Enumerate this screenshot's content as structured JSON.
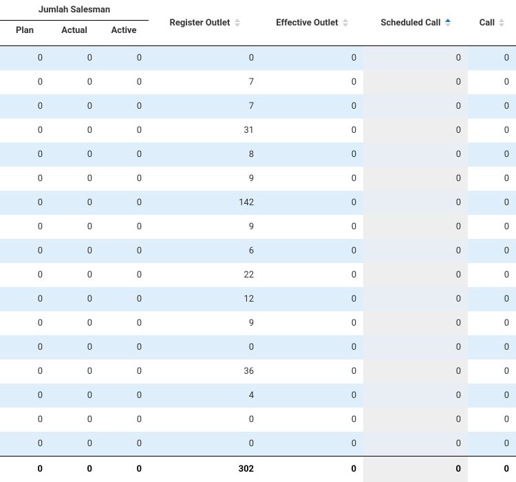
{
  "headers": {
    "group_salesman": "Jumlah Salesman",
    "plan": "Plan",
    "actual": "Actual",
    "active": "Active",
    "register_outlet": "Register Outlet",
    "effective_outlet": "Effective Outlet",
    "scheduled_call": "Scheduled Call",
    "call": "Call"
  },
  "sort": {
    "column": "scheduled_call",
    "direction": "asc"
  },
  "rows": [
    {
      "plan": 0,
      "actual": 0,
      "active": 0,
      "register_outlet": 0,
      "effective_outlet": 0,
      "scheduled_call": 0,
      "call": 0
    },
    {
      "plan": 0,
      "actual": 0,
      "active": 0,
      "register_outlet": 7,
      "effective_outlet": 0,
      "scheduled_call": 0,
      "call": 0
    },
    {
      "plan": 0,
      "actual": 0,
      "active": 0,
      "register_outlet": 7,
      "effective_outlet": 0,
      "scheduled_call": 0,
      "call": 0
    },
    {
      "plan": 0,
      "actual": 0,
      "active": 0,
      "register_outlet": 31,
      "effective_outlet": 0,
      "scheduled_call": 0,
      "call": 0
    },
    {
      "plan": 0,
      "actual": 0,
      "active": 0,
      "register_outlet": 8,
      "effective_outlet": 0,
      "scheduled_call": 0,
      "call": 0
    },
    {
      "plan": 0,
      "actual": 0,
      "active": 0,
      "register_outlet": 9,
      "effective_outlet": 0,
      "scheduled_call": 0,
      "call": 0
    },
    {
      "plan": 0,
      "actual": 0,
      "active": 0,
      "register_outlet": 142,
      "effective_outlet": 0,
      "scheduled_call": 0,
      "call": 0
    },
    {
      "plan": 0,
      "actual": 0,
      "active": 0,
      "register_outlet": 9,
      "effective_outlet": 0,
      "scheduled_call": 0,
      "call": 0
    },
    {
      "plan": 0,
      "actual": 0,
      "active": 0,
      "register_outlet": 6,
      "effective_outlet": 0,
      "scheduled_call": 0,
      "call": 0
    },
    {
      "plan": 0,
      "actual": 0,
      "active": 0,
      "register_outlet": 22,
      "effective_outlet": 0,
      "scheduled_call": 0,
      "call": 0
    },
    {
      "plan": 0,
      "actual": 0,
      "active": 0,
      "register_outlet": 12,
      "effective_outlet": 0,
      "scheduled_call": 0,
      "call": 0
    },
    {
      "plan": 0,
      "actual": 0,
      "active": 0,
      "register_outlet": 9,
      "effective_outlet": 0,
      "scheduled_call": 0,
      "call": 0
    },
    {
      "plan": 0,
      "actual": 0,
      "active": 0,
      "register_outlet": 0,
      "effective_outlet": 0,
      "scheduled_call": 0,
      "call": 0
    },
    {
      "plan": 0,
      "actual": 0,
      "active": 0,
      "register_outlet": 36,
      "effective_outlet": 0,
      "scheduled_call": 0,
      "call": 0
    },
    {
      "plan": 0,
      "actual": 0,
      "active": 0,
      "register_outlet": 4,
      "effective_outlet": 0,
      "scheduled_call": 0,
      "call": 0
    },
    {
      "plan": 0,
      "actual": 0,
      "active": 0,
      "register_outlet": 0,
      "effective_outlet": 0,
      "scheduled_call": 0,
      "call": 0
    },
    {
      "plan": 0,
      "actual": 0,
      "active": 0,
      "register_outlet": 0,
      "effective_outlet": 0,
      "scheduled_call": 0,
      "call": 0
    }
  ],
  "footer": {
    "plan": 0,
    "actual": 0,
    "active": 0,
    "register_outlet": 302,
    "effective_outlet": 0,
    "scheduled_call": 0,
    "call": 0
  }
}
